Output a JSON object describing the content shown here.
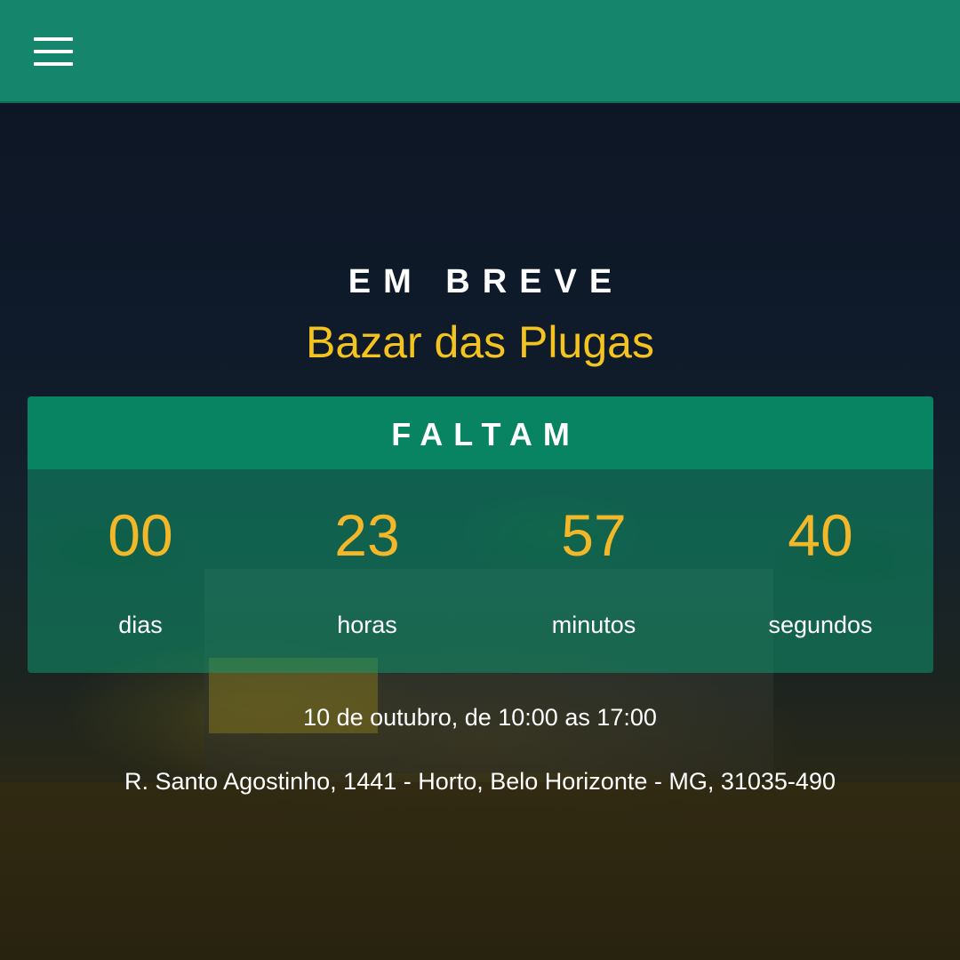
{
  "appbar": {
    "menu_icon": "hamburger-menu-icon",
    "color": "#15856b"
  },
  "hero": {
    "kicker": "EM BREVE",
    "title": "Bazar das Plugas",
    "title_color": "#f3c41f"
  },
  "countdown": {
    "header": "FALTAM",
    "units": [
      {
        "value": "00",
        "label": "dias"
      },
      {
        "value": "23",
        "label": "horas"
      },
      {
        "value": "57",
        "label": "minutos"
      },
      {
        "value": "40",
        "label": "segundos"
      }
    ],
    "number_color": "#f3b72a"
  },
  "details": {
    "date": "10 de outubro, de 10:00 as 17:00",
    "address": "R. Santo Agostinho, 1441 - Horto, Belo Horizonte - MG, 31035-490"
  }
}
